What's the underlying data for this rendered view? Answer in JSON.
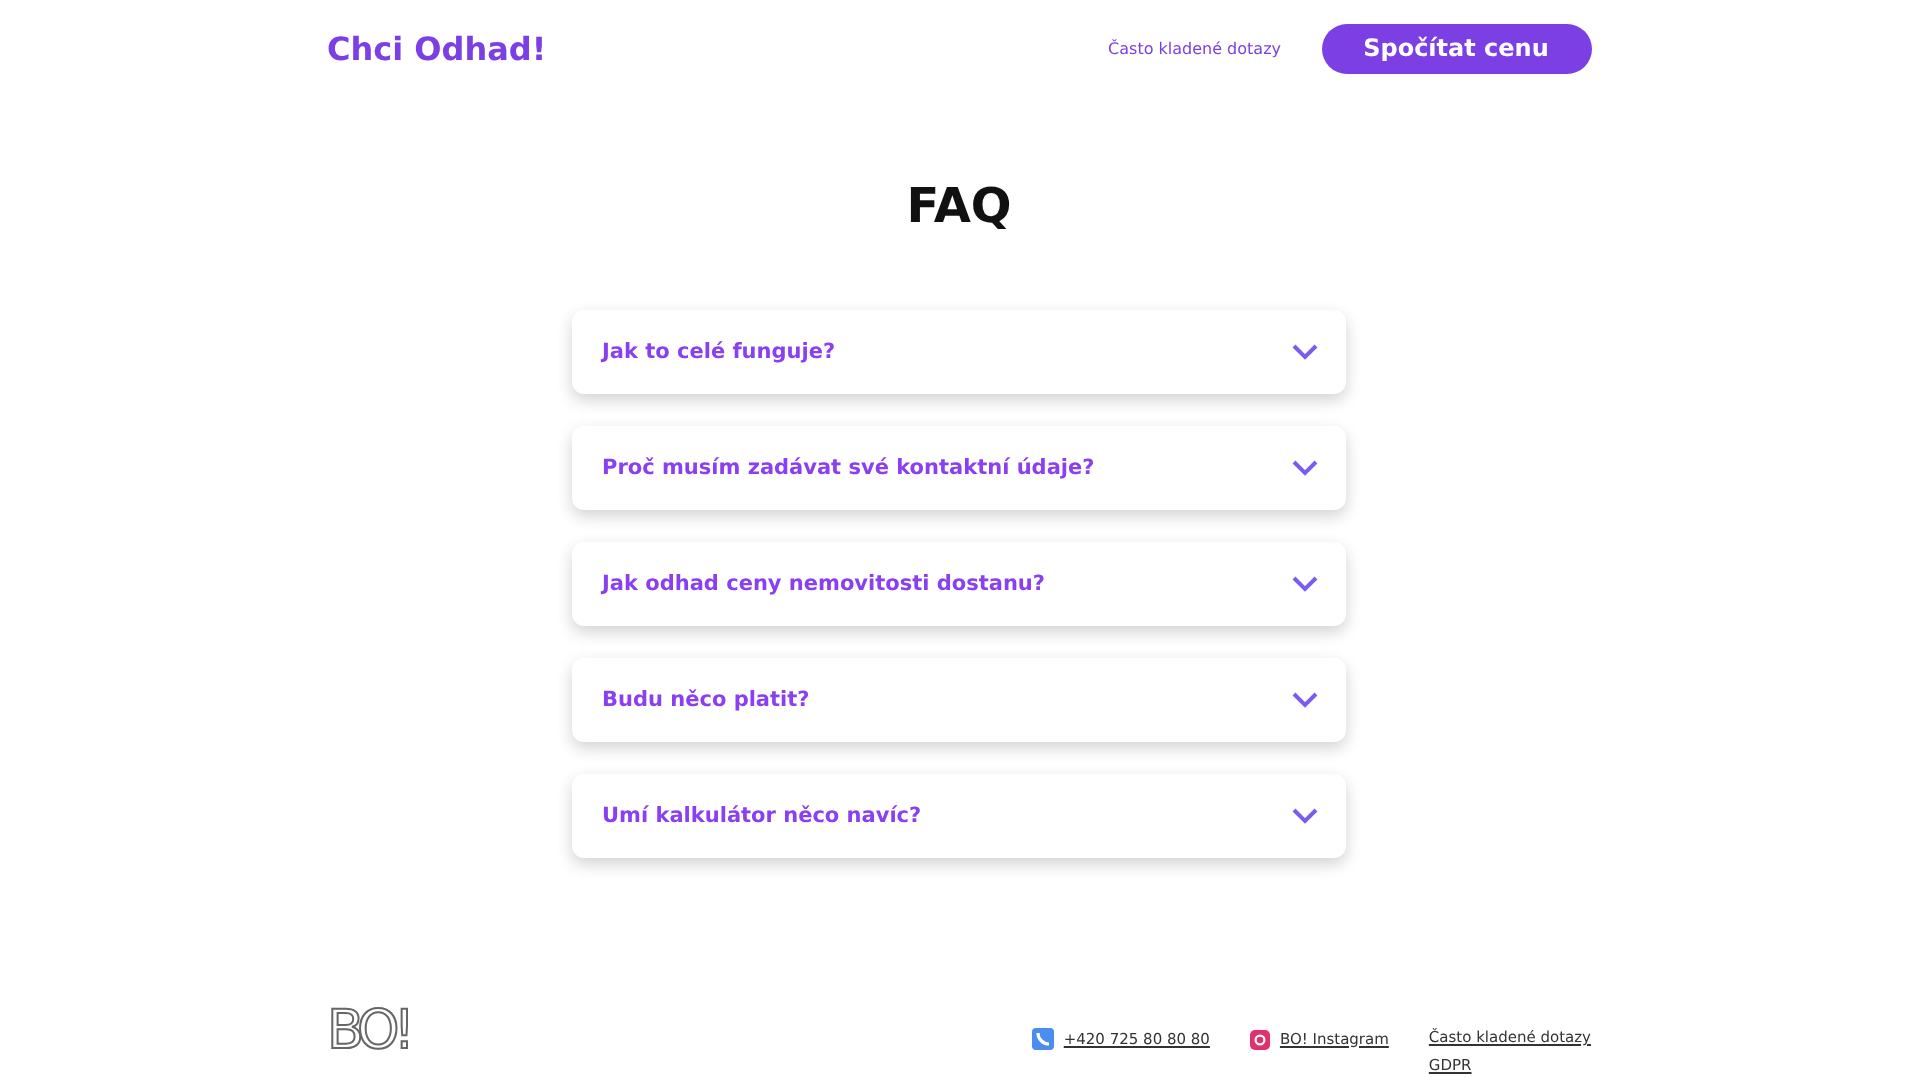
{
  "header": {
    "logo": "Chci Odhad!",
    "nav_link": "Často kladené dotazy",
    "cta_button": "Spočítat cenu"
  },
  "title": "FAQ",
  "faq": [
    {
      "question": "Jak to celé funguje?",
      "expanded": false
    },
    {
      "question": "Proč musím zadávat své kontaktní údaje?",
      "expanded": false
    },
    {
      "question": "Jak odhad ceny nemovitosti dostanu?",
      "expanded": false
    },
    {
      "question": "Budu něco platit?",
      "expanded": false
    },
    {
      "question": "Umí kalkulátor něco navíc?",
      "expanded": false
    }
  ],
  "footer": {
    "logo": "BO!",
    "phone": "+420 725 80 80 80",
    "instagram": "BO! Instagram",
    "links": [
      "Často kladené dotazy",
      "GDPR"
    ]
  }
}
